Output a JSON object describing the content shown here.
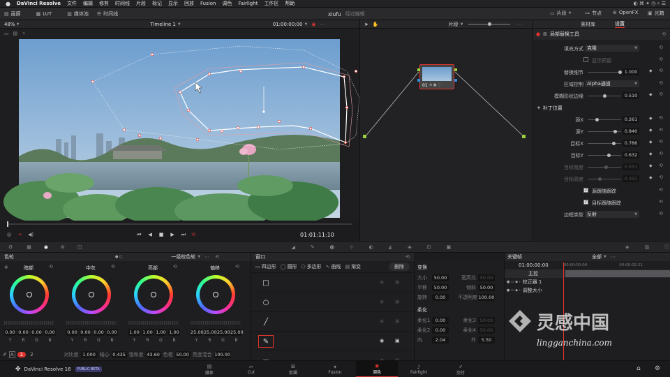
{
  "menubar": {
    "app_name": "DaVinci Resolve",
    "items": [
      "文件",
      "编辑",
      "修剪",
      "时间线",
      "片段",
      "标记",
      "显示",
      "回放",
      "Fusion",
      "调色",
      "Fairlight",
      "工作区",
      "帮助"
    ]
  },
  "toolbar": {
    "gallery": "画廊",
    "lut": "LUT",
    "media_pool": "媒体池",
    "timeline": "时间线",
    "project_name": "xiufu",
    "edited_status": "经过编辑",
    "clips": "片段",
    "nodes": "节点",
    "openfx": "OpenFX",
    "lightbox": "光箱"
  },
  "viewer": {
    "zoom": "48%",
    "timeline_name": "Timeline 1",
    "timecode_top": "01:00:00:00",
    "timecode_bottom": "01:01:11:10"
  },
  "node_editor": {
    "mode": "片段",
    "node_label": "01"
  },
  "settings": {
    "tab_library": "素材库",
    "tab_settings": "设置",
    "tool_title": "局部替换工具",
    "fill_mode_label": "填充方式",
    "fill_mode_value": "克隆",
    "show_patch_label": "显示预留",
    "replace_detail_label": "替换细节",
    "replace_detail_value": "1.000",
    "region_label": "区域控制",
    "region_value": "Alpha通道",
    "blur_label": "模糊形状边缘",
    "blur_value": "0.510",
    "patch_section": "补丁位置",
    "source_x_label": "源X",
    "source_x_value": "0.261",
    "source_y_label": "源Y",
    "source_y_value": "0.840",
    "target_x_label": "目标X",
    "target_x_value": "0.786",
    "target_y_label": "目标Y",
    "target_y_value": "0.632",
    "target_w_label": "目标宽度",
    "target_w_value": "0.551",
    "target_h_label": "目标高度",
    "target_h_value": "0.331",
    "source_follow_label": "源跟随跟踪",
    "target_follow_label": "目标跟随跟踪",
    "border_label": "边框类型",
    "border_value": "反射"
  },
  "color_wheels": {
    "title": "色轮",
    "mode": "一级校色轮",
    "wheels": [
      {
        "name": "暗部",
        "values": [
          "0.00",
          "0.00",
          "0.00",
          "0.00"
        ]
      },
      {
        "name": "中灰",
        "values": [
          "0.00",
          "0.00",
          "0.00",
          "0.00"
        ]
      },
      {
        "name": "亮部",
        "values": [
          "1.00",
          "1.00",
          "1.00",
          "1.00"
        ]
      },
      {
        "name": "偏移",
        "values": [
          "25.00",
          "25.00",
          "25.00",
          "25.00"
        ]
      }
    ],
    "channel_labels": [
      "Y",
      "R",
      "G",
      "B"
    ],
    "page_1": "1",
    "page_2": "2",
    "contrast_label": "对比度",
    "contrast_value": "1.000",
    "pivot_label": "轴心",
    "pivot_value": "0.435",
    "saturation_label": "饱和度",
    "saturation_value": "43.60",
    "hue_label": "色相",
    "hue_value": "50.00",
    "lum_mix_label": "亮度混合",
    "lum_mix_value": "100.00"
  },
  "window_panel": {
    "title": "窗口",
    "tools": [
      "四边形",
      "圆形",
      "多边形",
      "曲线",
      "渐变"
    ],
    "delete": "删除",
    "transform_title": "变换",
    "size_label": "大小",
    "size_value": "50.00",
    "aspect_label": "宽高比",
    "aspect_value": "50.00",
    "pan_label": "平移",
    "pan_value": "50.00",
    "tilt_label": "倾斜",
    "tilt_value": "50.00",
    "rotate_label": "旋转",
    "rotate_value": "0.00",
    "opacity_label": "不透明度",
    "opacity_value": "100.00",
    "softness_title": "柔化",
    "soft1_label": "柔化1",
    "soft1_value": "0.00",
    "soft2_label": "柔化2",
    "soft2_value": "0.00",
    "soft3_label": "柔化3",
    "soft3_value": "50.00",
    "soft4_label": "柔化4",
    "soft4_value": "50.00",
    "inside_label": "内",
    "inside_value": "2.04",
    "outside_label": "外",
    "outside_value": "5.50"
  },
  "keyframes": {
    "title": "关键帧",
    "filter": "全部",
    "timecode": "01:00:00:00",
    "tc_start": "00:00:00:00",
    "tc_end": "00:00:02:21",
    "master": "主控",
    "corrector": "校正器 1",
    "resize": "调整大小"
  },
  "bottom_bar": {
    "app": "DaVinci Resolve 16",
    "badge": "PUBLIC BETA",
    "pages": [
      "媒体",
      "Cut",
      "剪辑",
      "Fusion",
      "调色",
      "Fairlight",
      "交付"
    ],
    "active_page": "调色"
  },
  "watermark": {
    "brand": "灵感中国",
    "url": "lingganchina.com"
  },
  "colors": {
    "accent_red": "#e0342f",
    "panel_bg": "#1e1e20",
    "header_bg": "#262628"
  }
}
